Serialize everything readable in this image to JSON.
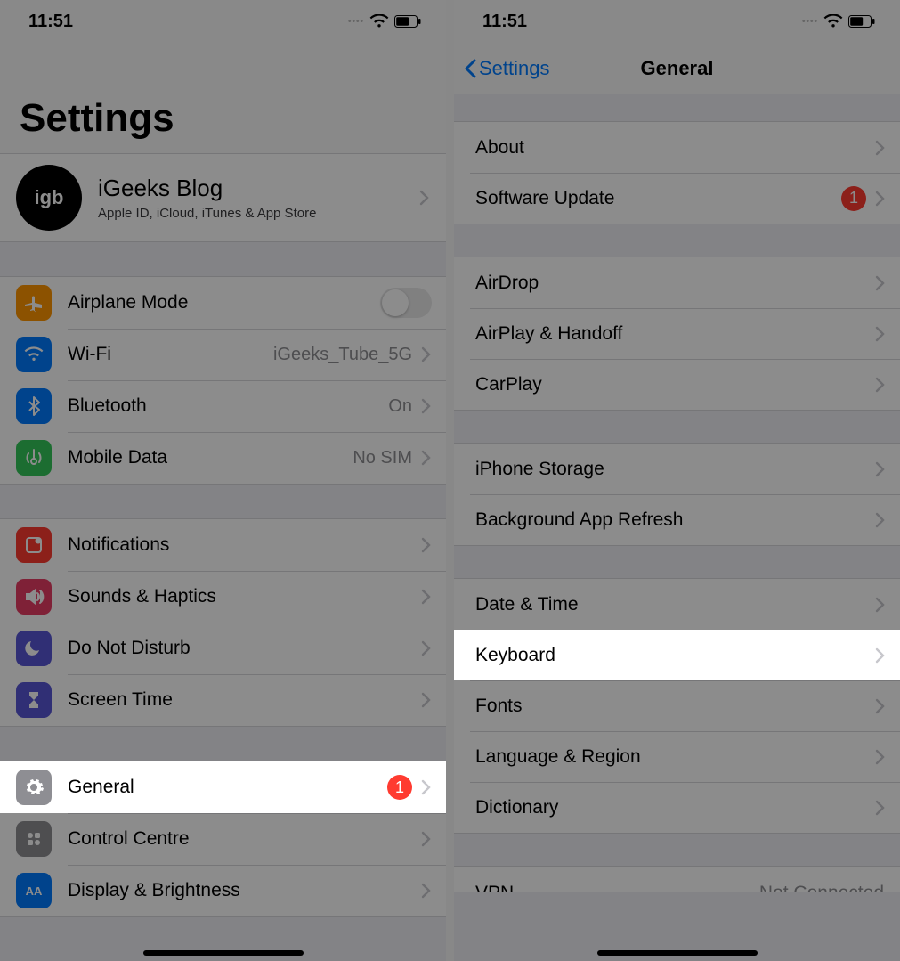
{
  "status": {
    "time": "11:51"
  },
  "left": {
    "title": "Settings",
    "apple_id": {
      "avatar_text": "iGB",
      "name": "iGeeks Blog",
      "subtitle": "Apple ID, iCloud, iTunes & App Store"
    },
    "g1": {
      "airplane": "Airplane Mode",
      "wifi": "Wi-Fi",
      "wifi_val": "iGeeks_Tube_5G",
      "bt": "Bluetooth",
      "bt_val": "On",
      "mobile": "Mobile Data",
      "mobile_val": "No SIM"
    },
    "g2": {
      "notif": "Notifications",
      "sounds": "Sounds & Haptics",
      "dnd": "Do Not Disturb",
      "screentime": "Screen Time"
    },
    "g3": {
      "general": "General",
      "general_badge": "1",
      "control": "Control Centre",
      "display": "Display & Brightness"
    }
  },
  "right": {
    "back": "Settings",
    "title": "General",
    "g1": {
      "about": "About",
      "swupdate": "Software Update",
      "swbadge": "1"
    },
    "g2": {
      "airdrop": "AirDrop",
      "airplay": "AirPlay & Handoff",
      "carplay": "CarPlay"
    },
    "g3": {
      "storage": "iPhone Storage",
      "bgapp": "Background App Refresh"
    },
    "g4": {
      "datetime": "Date & Time",
      "keyboard": "Keyboard",
      "fonts": "Fonts",
      "lang": "Language & Region",
      "dict": "Dictionary"
    },
    "peek": {
      "vpn": "VPN",
      "vpn_val": "Not Connected"
    }
  },
  "colors": {
    "orange": "#ff9500",
    "blue": "#007aff",
    "green": "#34c759",
    "red": "#ff3b30",
    "indigo": "#5856d6",
    "purple": "#5856d6",
    "gray": "#8e8e93",
    "darkred": "#e73c3c"
  }
}
